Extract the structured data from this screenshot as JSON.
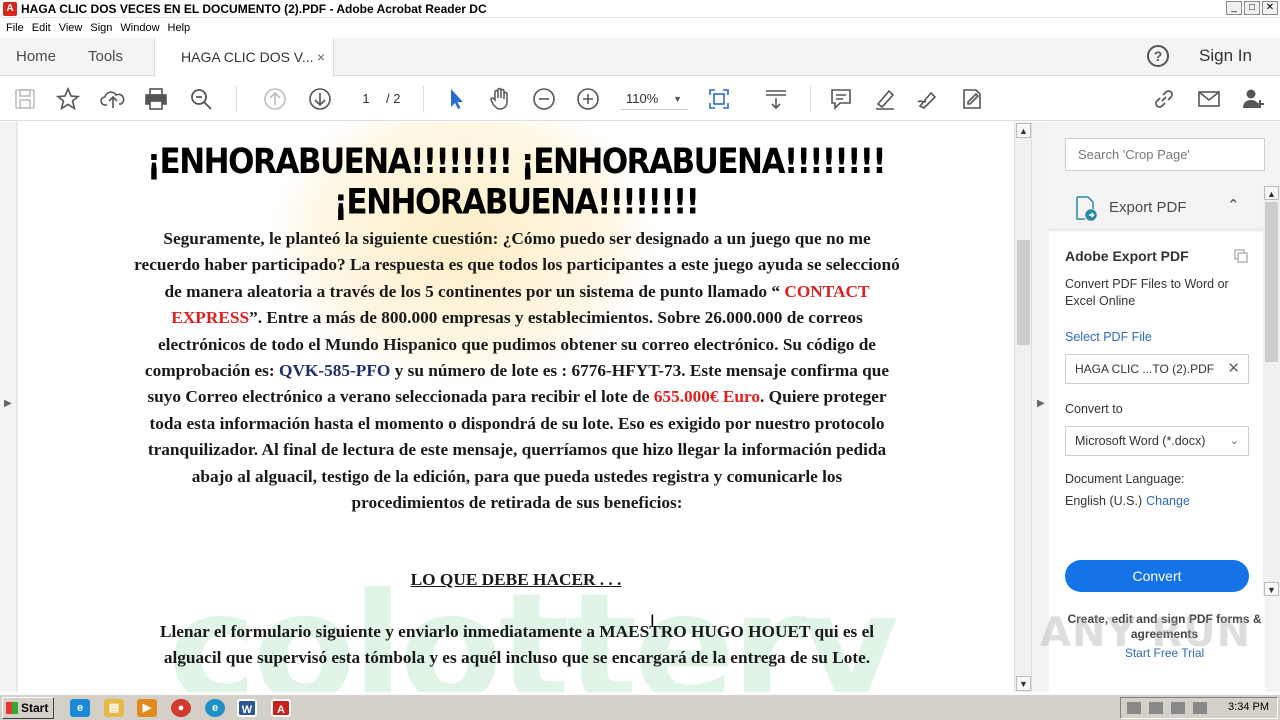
{
  "window": {
    "title": "HAGA CLIC DOS VECES EN EL DOCUMENTO (2).PDF - Adobe Acrobat Reader DC",
    "min": "_",
    "max": "□",
    "close": "✕"
  },
  "menu": [
    "File",
    "Edit",
    "View",
    "Sign",
    "Window",
    "Help"
  ],
  "tabs": {
    "home": "Home",
    "tools": "Tools",
    "doc": "HAGA CLIC DOS V...",
    "close": "×"
  },
  "header": {
    "help": "?",
    "signin": "Sign In"
  },
  "toolbar": {
    "page_current": "1",
    "page_total": "/ 2",
    "zoom": "110%"
  },
  "document": {
    "headline": "¡ENHORABUENA!!!!!!!! ¡ENHORABUENA!!!!!!!! ¡ENHORABUENA!!!!!!!!",
    "p1_a": "Seguramente, le planteó la siguiente cuestión: ¿Cómo puedo ser designado a un juego que no me recuerdo haber participado? La respuesta es que todos los participantes a este juego ayuda se seleccionó de manera aleatoria a través de los 5 continentes por un sistema de punto llamado “ ",
    "p1_contact": "CONTACT EXPRESS",
    "p1_b": "”. Entre a más de 800.000 empresas y establecimientos. Sobre 26.000.000 de correos electrónicos de todo el Mundo Hispanico que pudimos obtener su correo electrónico. Su código de comprobación es: ",
    "p1_code": "QVK-585-PFO",
    "p1_c": " y su número de lote es : 6776-HFYT-73. Este mensaje confirma que suyo Correo electrónico a verano seleccionada para recibir el lote de ",
    "p1_amount": "655.000€ Euro",
    "p1_d": ". Quiere proteger toda esta información hasta el momento o dispondrá de su lote. Eso es exigido por nuestro protocolo tranquilizador. Al final de lectura de este mensaje, querríamos que hizo llegar la información pedida abajo al alguacil, testigo de la edición, para que pueda ustedes registra y comunicarle los procedimientos de retirada de sus beneficios:",
    "subhead": "LO QUE DEBE HACER . . .",
    "p2": "Llenar el formulario siguiente y enviarlo inmediatamente a MAESTRO HUGO HOUET qui es el alguacil que supervisó esta tómbola y es aquél incluso que se encargará de la entrega de su Lote."
  },
  "panel": {
    "search_placeholder": "Search 'Crop Page'",
    "export_label": "Export PDF",
    "card_title": "Adobe Export PDF",
    "card_desc": "Convert PDF Files to Word or Excel Online",
    "select_label": "Select PDF File",
    "file_name": "HAGA CLIC ...TO (2).PDF",
    "convert_to_label": "Convert to",
    "convert_to_value": "Microsoft Word (*.docx)",
    "lang_label": "Document Language:",
    "lang_value": "English (U.S.)",
    "lang_change": "Change",
    "convert_button": "Convert",
    "promo_text": "Create, edit and sign PDF forms & agreements",
    "promo_link": "Start Free Trial"
  },
  "watermark": "ANY RUN",
  "taskbar": {
    "start": "Start",
    "clock": "3:34 PM"
  },
  "colors": {
    "accent": "#1473e6",
    "link": "#2d6bb8",
    "red_text": "#e02020",
    "code_blue": "#1e2f6b"
  }
}
